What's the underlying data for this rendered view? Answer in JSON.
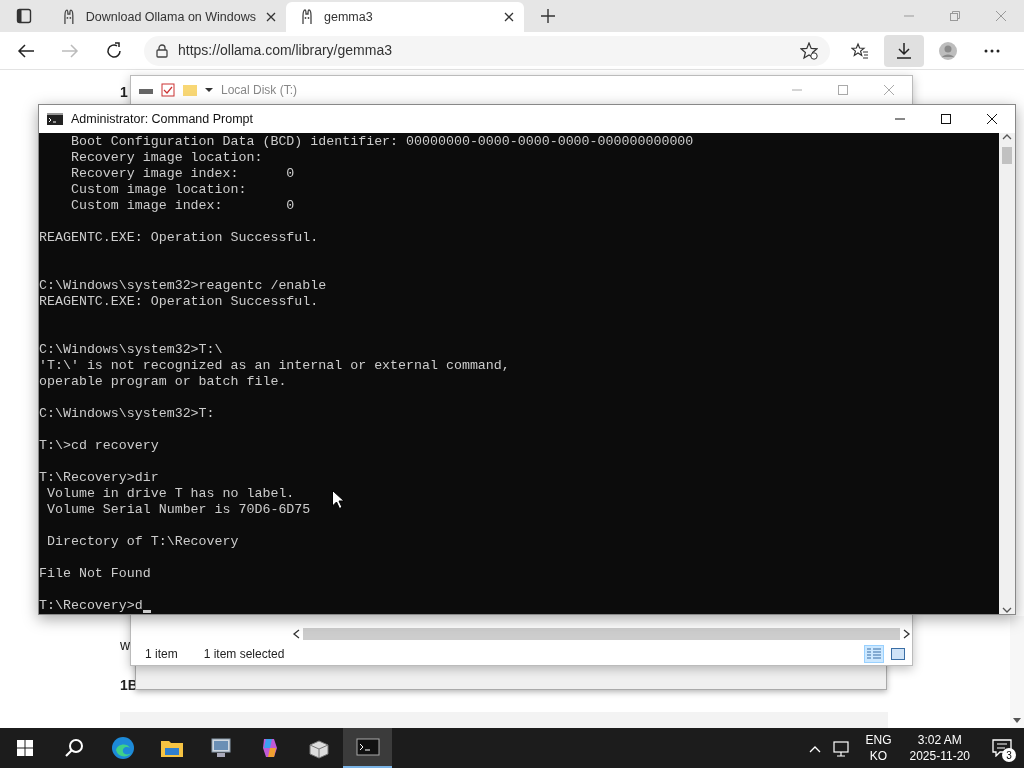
{
  "browser": {
    "tabs": [
      {
        "title": "Download Ollama on Windows",
        "selected": false
      },
      {
        "title": "gemma3",
        "selected": true
      }
    ],
    "forward_disabled": true,
    "address": {
      "url": "https://ollama.com/library/gemma3"
    },
    "downloads_active": true,
    "page_fragments": [
      "1",
      "w",
      "1B"
    ]
  },
  "explorer": {
    "title": "Local Disk (T:)",
    "status": [
      "1 item",
      "1 item selected"
    ],
    "details_view_selected": true
  },
  "cmd": {
    "title": "Administrator: Command Prompt",
    "console": "    Boot Configuration Data (BCD) identifier: 00000000-0000-0000-0000-000000000000\n    Recovery image location:\n    Recovery image index:      0\n    Custom image location:\n    Custom image index:        0\n\nREAGENTC.EXE: Operation Successful.\n\n\nC:\\Windows\\system32>reagentc /enable\nREAGENTC.EXE: Operation Successful.\n\n\nC:\\Windows\\system32>T:\\\n'T:\\' is not recognized as an internal or external command,\noperable program or batch file.\n\nC:\\Windows\\system32>T:\n\nT:\\>cd recovery\n\nT:\\Recovery>dir\n Volume in drive T has no label.\n Volume Serial Number is 70D6-6D75\n\n Directory of T:\\Recovery\n\nFile Not Found\n\nT:\\Recovery>d",
    "cursor": true
  },
  "taskbar": {
    "apps": [
      {
        "kind": "edge",
        "active": false
      },
      {
        "kind": "explorer",
        "active": false
      },
      {
        "kind": "monitor",
        "active": false
      },
      {
        "kind": "copilot",
        "active": false
      },
      {
        "kind": "package",
        "active": false
      },
      {
        "kind": "cmd",
        "active": true
      }
    ],
    "language": [
      "ENG",
      "KO"
    ],
    "time": "3:02 AM",
    "date": "2025-11-20",
    "notifications": "3"
  }
}
